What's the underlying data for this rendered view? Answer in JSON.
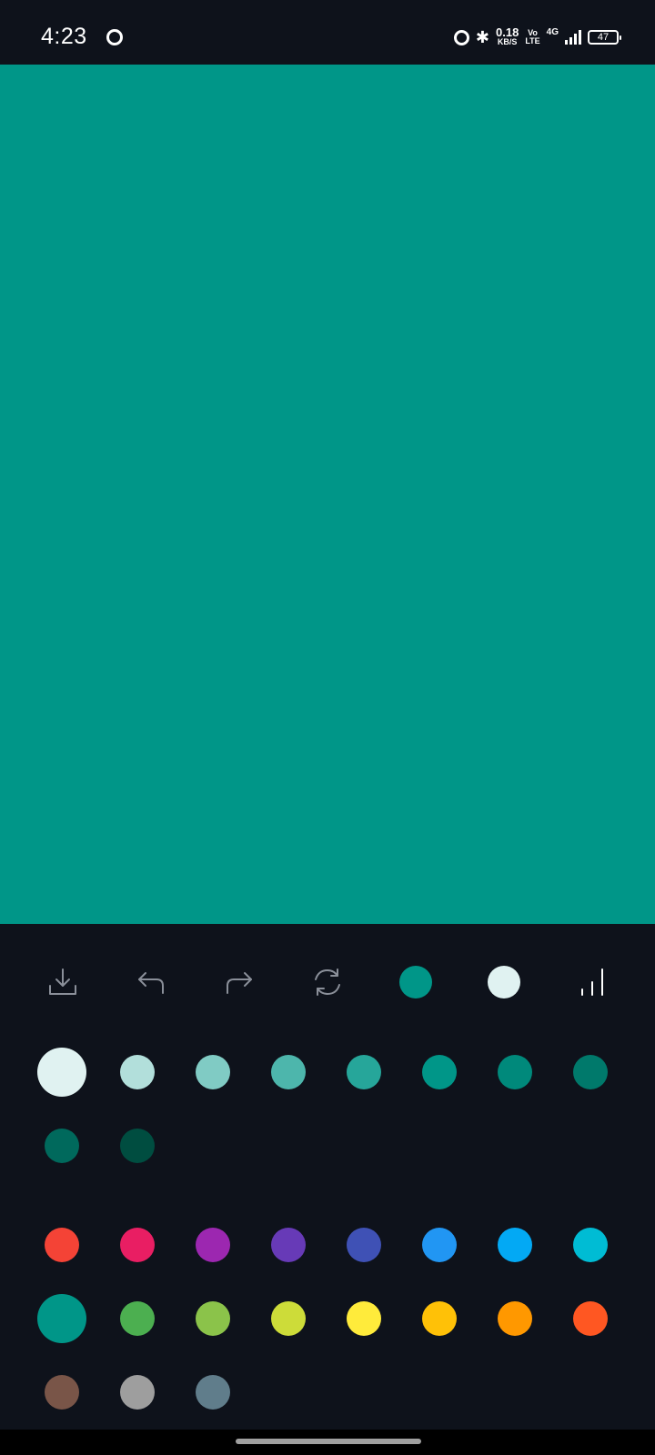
{
  "status_bar": {
    "time": "4:23",
    "net_speed_value": "0.18",
    "net_speed_unit": "KB/S",
    "volte_top": "Vo",
    "volte_bottom": "LTE",
    "network_type": "4G",
    "battery": "47",
    "icons": [
      "app-notification-icon",
      "alarm-icon",
      "bluetooth-icon",
      "signal-icon",
      "battery-icon"
    ]
  },
  "canvas": {
    "color": "#009688"
  },
  "toolbar": {
    "icons": [
      "download-icon",
      "undo-icon",
      "redo-icon",
      "refresh-icon",
      "primary-color-swatch",
      "secondary-color-swatch",
      "stroke-size-icon"
    ],
    "primary_color": "#009688",
    "secondary_color": "#e0f2f1"
  },
  "palette": {
    "shades": [
      "#e0f2f1",
      "#b2dfdb",
      "#80cbc4",
      "#4db6ac",
      "#26a69a",
      "#009688",
      "#00897b",
      "#00796b",
      "#00695c",
      "#004d40"
    ],
    "selected_shade_index": 0,
    "colors": [
      "#f44336",
      "#e91e63",
      "#9c27b0",
      "#673ab7",
      "#3f51b5",
      "#2196f3",
      "#03a9f4",
      "#00bcd4",
      "#009688",
      "#4caf50",
      "#8bc34a",
      "#cddc39",
      "#ffeb3b",
      "#ffc107",
      "#ff9800",
      "#ff5722",
      "#795548",
      "#9e9e9e",
      "#607d8b"
    ],
    "selected_color_index": 8
  }
}
